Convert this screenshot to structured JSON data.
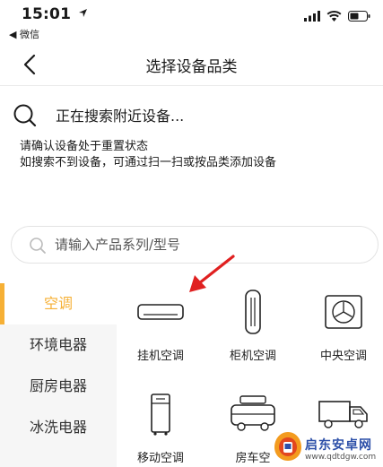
{
  "status_bar": {
    "time": "15:01",
    "location_icon": "location-arrow-icon",
    "back_app": "微信",
    "icons": [
      "signal-icon",
      "wifi-icon",
      "battery-icon"
    ]
  },
  "nav": {
    "back_icon": "chevron-left-icon",
    "title": "选择设备品类"
  },
  "scan": {
    "icon": "search-icon",
    "text": "正在搜索附近设备..."
  },
  "hint": {
    "line1": "请确认设备处于重置状态",
    "line2": "如搜索不到设备，可通过扫一扫或按品类添加设备"
  },
  "search": {
    "placeholder": "请输入产品系列/型号",
    "value": ""
  },
  "sidebar": {
    "items": [
      {
        "label": "空调",
        "active": true
      },
      {
        "label": "环境电器",
        "active": false
      },
      {
        "label": "厨房电器",
        "active": false
      },
      {
        "label": "冰洗电器",
        "active": false
      }
    ]
  },
  "grid": {
    "items": [
      {
        "label": "挂机空调",
        "icon": "wall-ac-icon"
      },
      {
        "label": "柜机空调",
        "icon": "tower-ac-icon"
      },
      {
        "label": "中央空调",
        "icon": "central-ac-icon"
      },
      {
        "label": "移动空调",
        "icon": "portable-ac-icon"
      },
      {
        "label": "房车空",
        "icon": "rv-ac-icon"
      },
      {
        "label": "",
        "icon": "truck-ac-icon"
      }
    ]
  },
  "overlay": {
    "arrow_icon": "red-arrow-icon",
    "watermark_text": "启东安卓网",
    "watermark_url": "www.qdtdgw.com"
  },
  "colors": {
    "accent": "#f6b035",
    "arrow": "#e02020",
    "sidebar_bg": "#f6f6f6"
  }
}
